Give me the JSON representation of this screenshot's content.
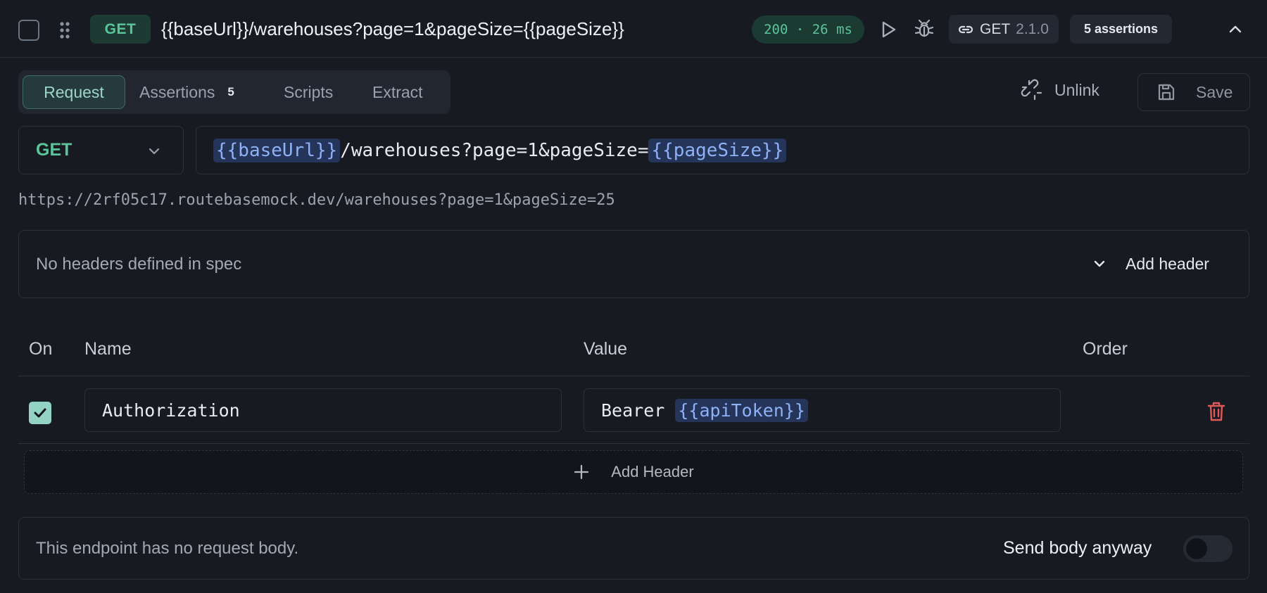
{
  "top": {
    "method": "GET",
    "url": "{{baseUrl}}/warehouses?page=1&pageSize={{pageSize}}",
    "status": "200 · 26 ms",
    "spec_method": "GET",
    "spec_version": "2.1.0",
    "assertions": "5 assertions"
  },
  "tabs": [
    {
      "label": "Request",
      "active": true
    },
    {
      "label": "Assertions",
      "count": "5"
    },
    {
      "label": "Scripts"
    },
    {
      "label": "Extract"
    }
  ],
  "actions": {
    "unlink": "Unlink",
    "save": "Save"
  },
  "request": {
    "method": "GET",
    "url_var1": "{{baseUrl}}",
    "url_mid": "/warehouses?page=1&pageSize=",
    "url_var2": "{{pageSize}}",
    "resolved_url": "https://2rf05c17.routebasemock.dev/warehouses?page=1&pageSize=25"
  },
  "headers_spec": {
    "message": "No headers defined in spec",
    "add_label": "Add header"
  },
  "header_table": {
    "columns": {
      "on": "On",
      "name": "Name",
      "value": "Value",
      "order": "Order"
    },
    "rows": [
      {
        "enabled": true,
        "name": "Authorization",
        "value_prefix": "Bearer ",
        "value_var": "{{apiToken}}"
      }
    ],
    "add_label": "Add Header"
  },
  "body": {
    "message": "This endpoint has no request body.",
    "toggle_label": "Send body anyway",
    "toggle_on": false
  },
  "colors": {
    "accent_green": "#5bc49a",
    "variable_blue": "#8fb1f5",
    "danger": "#e05a5a",
    "background": "#171a21"
  }
}
